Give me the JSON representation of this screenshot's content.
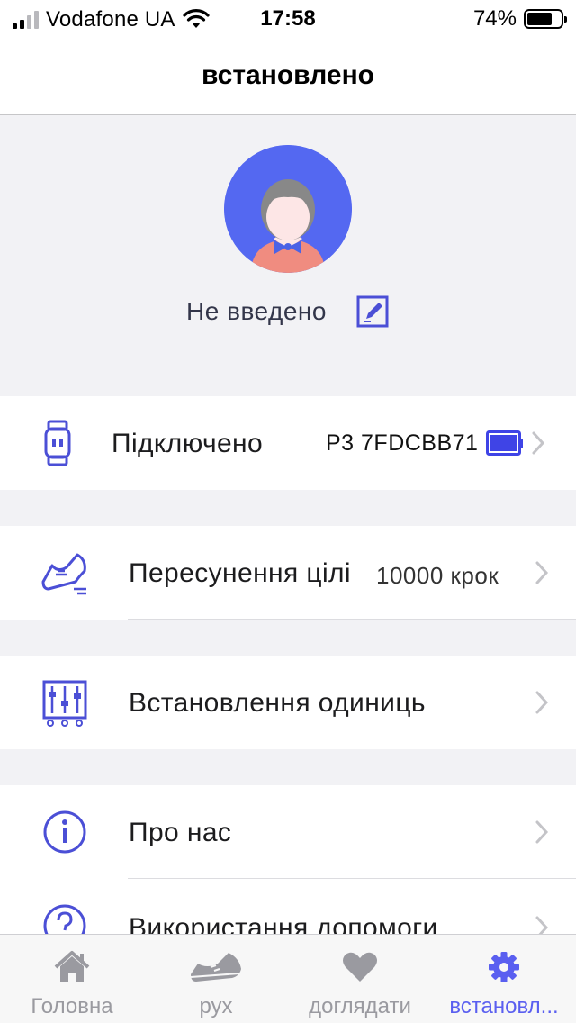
{
  "status_bar": {
    "carrier": "Vodafone UA",
    "time": "17:58",
    "battery_percent": "74%",
    "battery_level": 0.74,
    "signal_bars": 2
  },
  "nav": {
    "title": "встановлено"
  },
  "profile": {
    "name": "Не введено",
    "avatar_icon": "user-avatar-icon",
    "edit_icon": "edit-icon"
  },
  "rows": [
    {
      "label": "Підключено",
      "value": "P3 7FDCBB71",
      "icon": "watch-icon",
      "extra_icon": "battery-full-icon"
    },
    {
      "label": "Пересунення цілі",
      "value": "10000 крок",
      "icon": "shoe-icon"
    },
    {
      "label": "Встановлення одиниць",
      "value": "",
      "icon": "sliders-icon"
    },
    {
      "label": "Про нас",
      "value": "",
      "icon": "info-icon"
    },
    {
      "label": "Використання допомоги",
      "value": "",
      "icon": "help-icon"
    }
  ],
  "tabs": [
    {
      "label": "Головна",
      "icon": "home-icon"
    },
    {
      "label": "рух",
      "icon": "shoe-icon"
    },
    {
      "label": "доглядати",
      "icon": "heart-icon"
    },
    {
      "label": "встановл...",
      "icon": "gear-icon",
      "active": true
    }
  ],
  "colors": {
    "accent": "#5a5ff0",
    "avatar_bg": "#5468f1",
    "background": "#f2f2f5",
    "tab_inactive": "#9a9aa0"
  }
}
